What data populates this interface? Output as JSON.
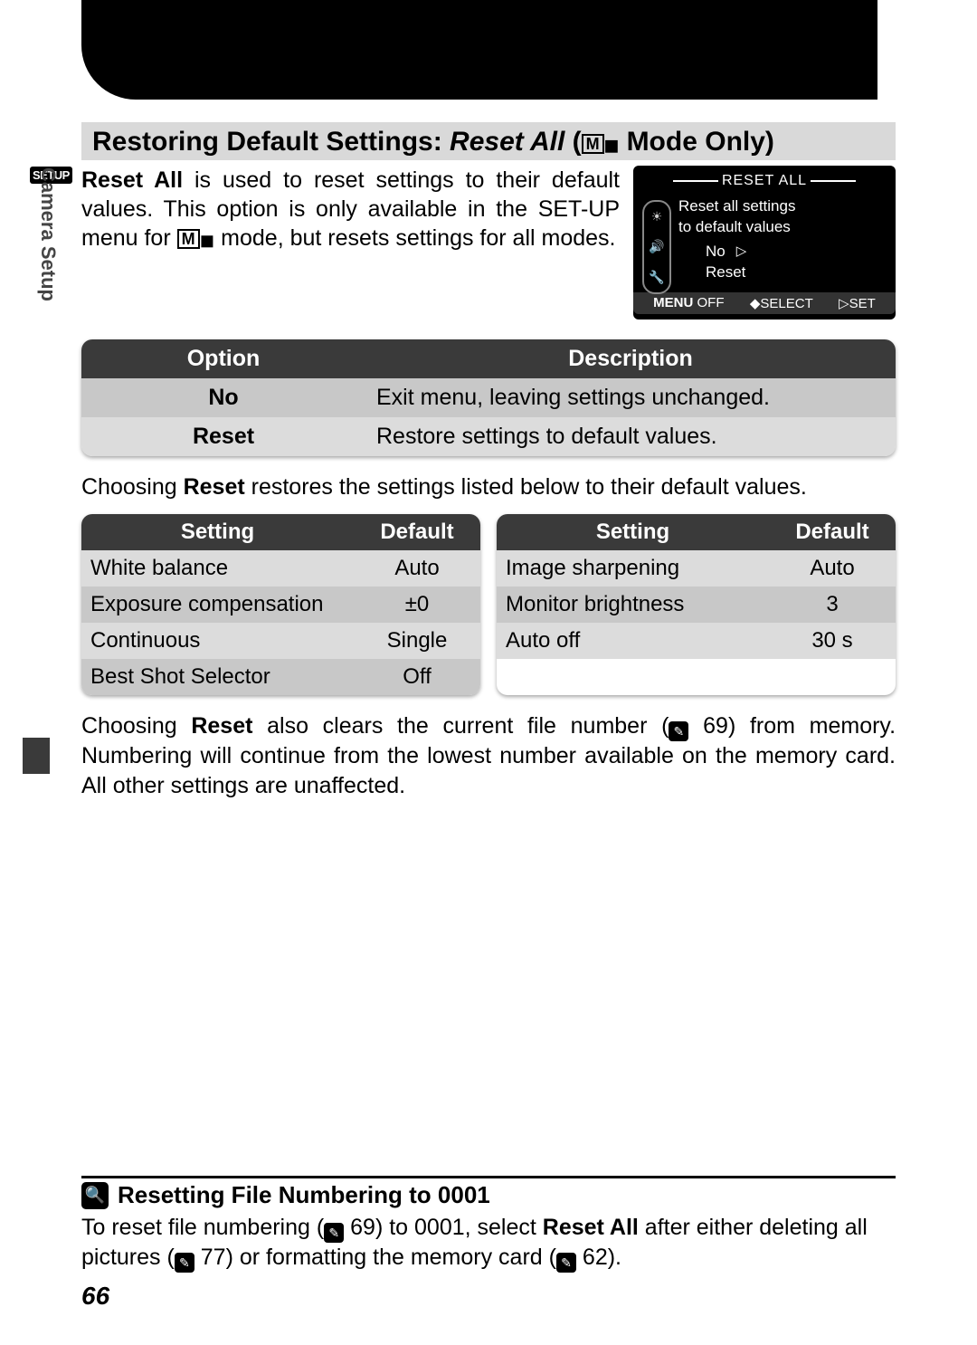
{
  "vertical_label": "Camera Setup",
  "setup_badge": "SETUP",
  "heading": {
    "prefix": "Restoring Default Settings: ",
    "italic": "Reset All",
    "suffix_a": " (",
    "mode_m": "M",
    "suffix_b": " Mode Only)"
  },
  "intro": {
    "bold1": "Reset All",
    "text1": " is used to reset settings to their default values.  This option is only available in the SET-UP menu for ",
    "mode_m": "M",
    "text2": " mode, but resets settings for all modes."
  },
  "screenshot": {
    "title": "RESET ALL",
    "line1": "Reset all settings",
    "line2": "to default values",
    "opt_no": "No",
    "opt_reset": "Reset",
    "foot_menu": "MENU",
    "foot_off": "OFF",
    "foot_select": "SELECT",
    "foot_set": "SET"
  },
  "table1": {
    "h1": "Option",
    "h2": "Description",
    "rows": [
      {
        "opt": "No",
        "desc": "Exit menu, leaving settings unchanged."
      },
      {
        "opt": "Reset",
        "desc": "Restore settings to default values."
      }
    ]
  },
  "para1": {
    "a": "Choosing ",
    "b": "Reset",
    "c": " restores the settings listed below to their default values."
  },
  "table2_headers": {
    "setting": "Setting",
    "default": "Default"
  },
  "defaults_left": [
    {
      "setting": "White balance",
      "default": "Auto"
    },
    {
      "setting": "Exposure compensation",
      "default": "±0"
    },
    {
      "setting": "Continuous",
      "default": "Single"
    },
    {
      "setting": "Best Shot Selector",
      "default": "Off"
    }
  ],
  "defaults_right": [
    {
      "setting": "Image sharpening",
      "default": "Auto"
    },
    {
      "setting": "Monitor brightness",
      "default": "3"
    },
    {
      "setting": "Auto off",
      "default": "30 s"
    }
  ],
  "para2": {
    "a": "Choosing ",
    "b": "Reset",
    "c": " also clears the current file number (",
    "ref1": "69",
    "d": ") from memory.  Numbering will continue from the lowest number available on the memory card.  All other settings are unaffected."
  },
  "note": {
    "title": "Resetting File Numbering to 0001",
    "a": "To reset file numbering (",
    "ref1": "69",
    "b": ") to 0001, select ",
    "bold": "Reset All",
    "c": " after either deleting all pictures (",
    "ref2": "77",
    "d": ") or formatting the memory card (",
    "ref3": "62",
    "e": ")."
  },
  "page_number": "66"
}
